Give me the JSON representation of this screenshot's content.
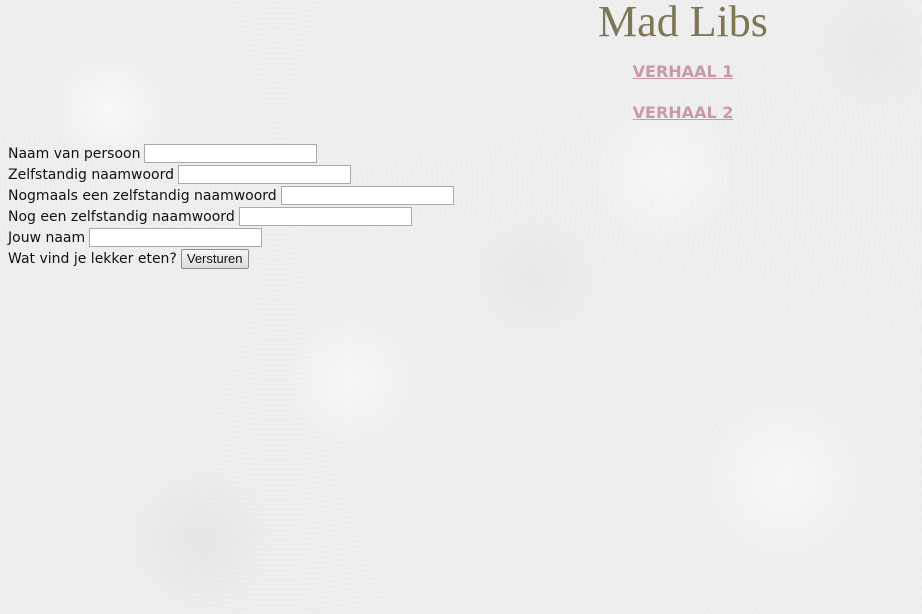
{
  "page": {
    "title": "Mad Libs"
  },
  "links": [
    {
      "label": "VERHAAL 1"
    },
    {
      "label": "VERHAAL 2"
    }
  ],
  "form": {
    "fields": [
      {
        "label": "Naam van persoon",
        "value": ""
      },
      {
        "label": "Zelfstandig naamwoord",
        "value": ""
      },
      {
        "label": "Nogmaals een zelfstandig naamwoord",
        "value": ""
      },
      {
        "label": "Nog een zelfstandig naamwoord",
        "value": ""
      },
      {
        "label": "Jouw naam",
        "value": ""
      }
    ],
    "question": "Wat vind je lekker eten?",
    "submit_label": "Versturen"
  },
  "colors": {
    "title": "#7d7758",
    "link": "#c79aa6",
    "background": "#efefef"
  }
}
